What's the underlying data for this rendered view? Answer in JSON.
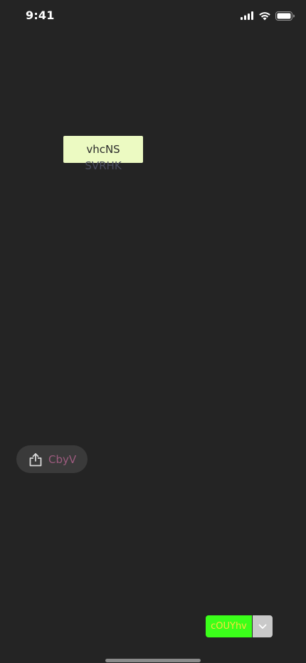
{
  "status_bar": {
    "time": "9:41",
    "icons": [
      "cellular-signal-icon",
      "wifi-icon",
      "battery-icon"
    ]
  },
  "tag_card": {
    "title": "vhcNS",
    "subtitle": "SVRHK",
    "background_color": "#ecfac2"
  },
  "share_button": {
    "icon": "share-icon",
    "label": "CbyV",
    "label_color": "#9c5b7e"
  },
  "split_button": {
    "label": "cOUYhv",
    "main_color": "#3bff1a",
    "label_color": "#f7e23c",
    "toggle_icon": "chevron-down-icon"
  },
  "colors": {
    "background": "#242424"
  }
}
